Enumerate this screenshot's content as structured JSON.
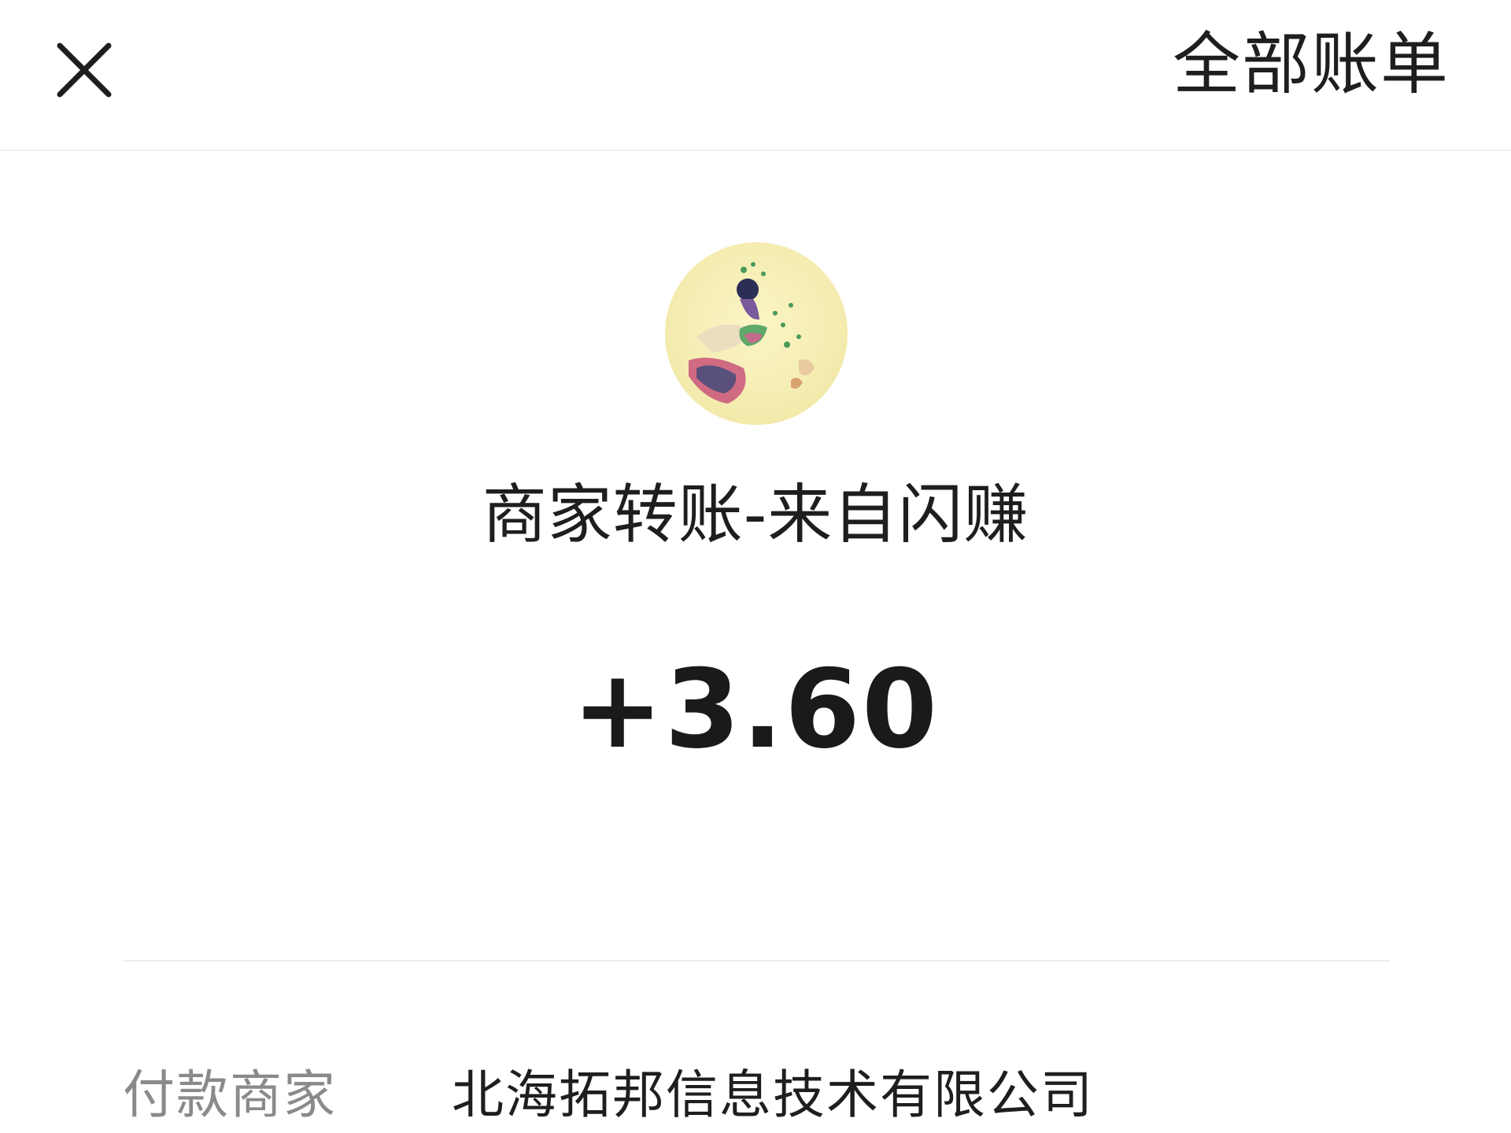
{
  "header": {
    "close_icon": "close-icon",
    "all_bills_label": "全部账单"
  },
  "merchant": {
    "avatar_icon": "merchant-avatar",
    "title": "商家转账-来自闪赚"
  },
  "transaction": {
    "amount": "+3.60"
  },
  "details": [
    {
      "label": "付款商家",
      "value": "北海拓邦信息技术有限公司"
    }
  ],
  "colors": {
    "background": "#ffffff",
    "text_primary": "#1e1e1e",
    "text_secondary": "#8a8a8a",
    "divider": "#ececec",
    "avatar_bg": "#f4ecb0"
  }
}
